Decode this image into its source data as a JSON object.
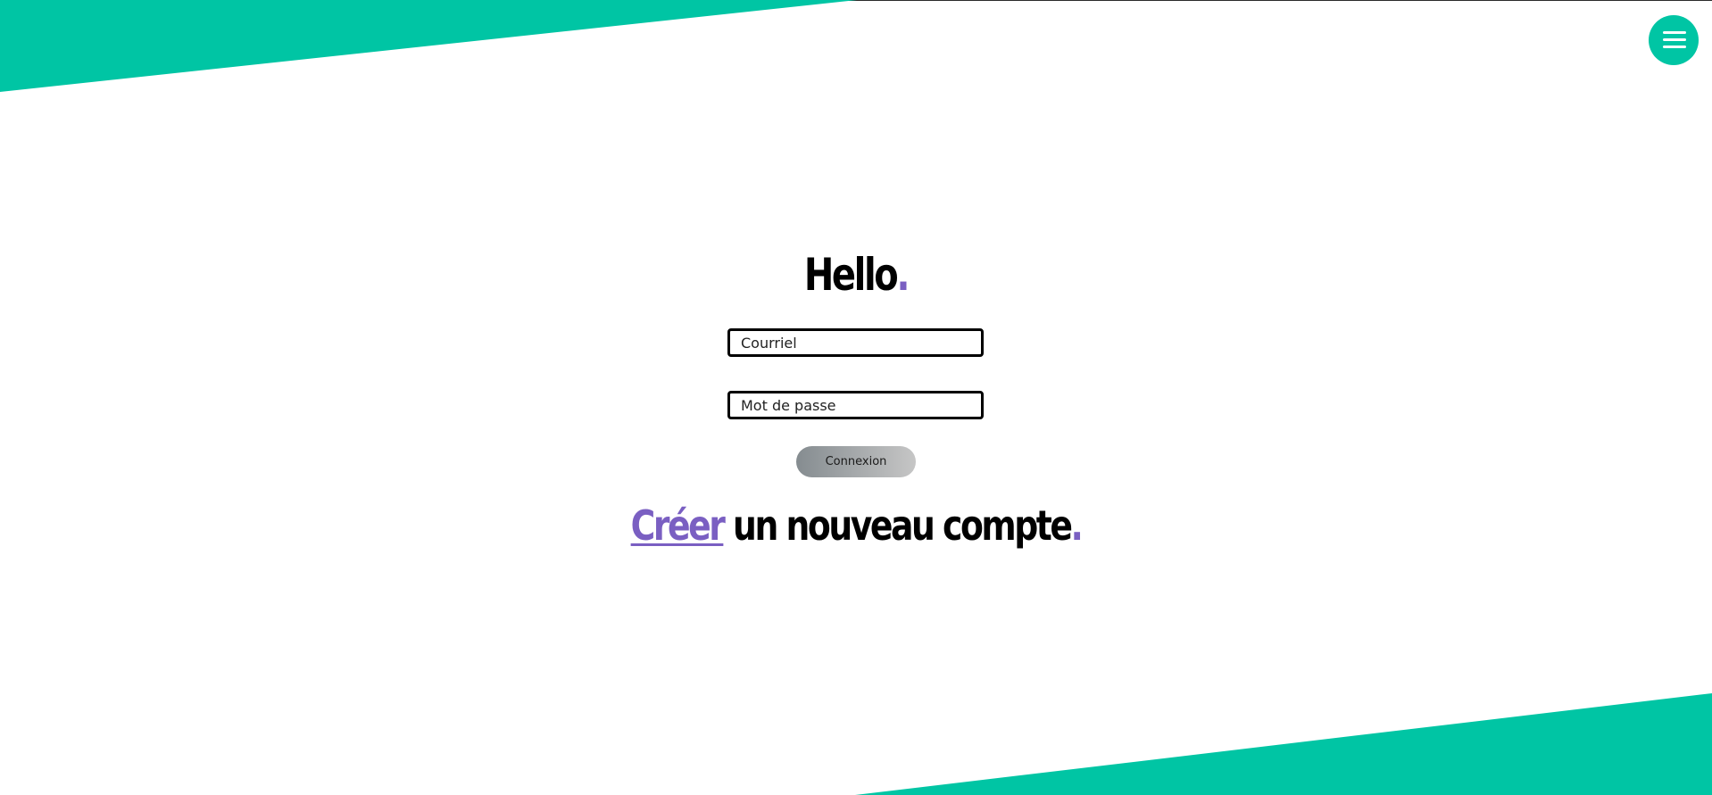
{
  "theme": {
    "accent_green": "#00c5a4",
    "accent_purple": "#7a5fc2",
    "button_gradient": [
      "#858c90",
      "#c6c6c6"
    ]
  },
  "nav": {
    "menu_icon": "hamburger-menu-icon"
  },
  "login": {
    "heading": "Hello",
    "heading_dot": ".",
    "email": {
      "placeholder": "Courriel",
      "value": ""
    },
    "password": {
      "placeholder": "Mot de passe",
      "value": ""
    },
    "submit_label": "Connexion"
  },
  "signup": {
    "link_label": "Créer",
    "rest_text": " un nouveau compte",
    "dot": "."
  }
}
